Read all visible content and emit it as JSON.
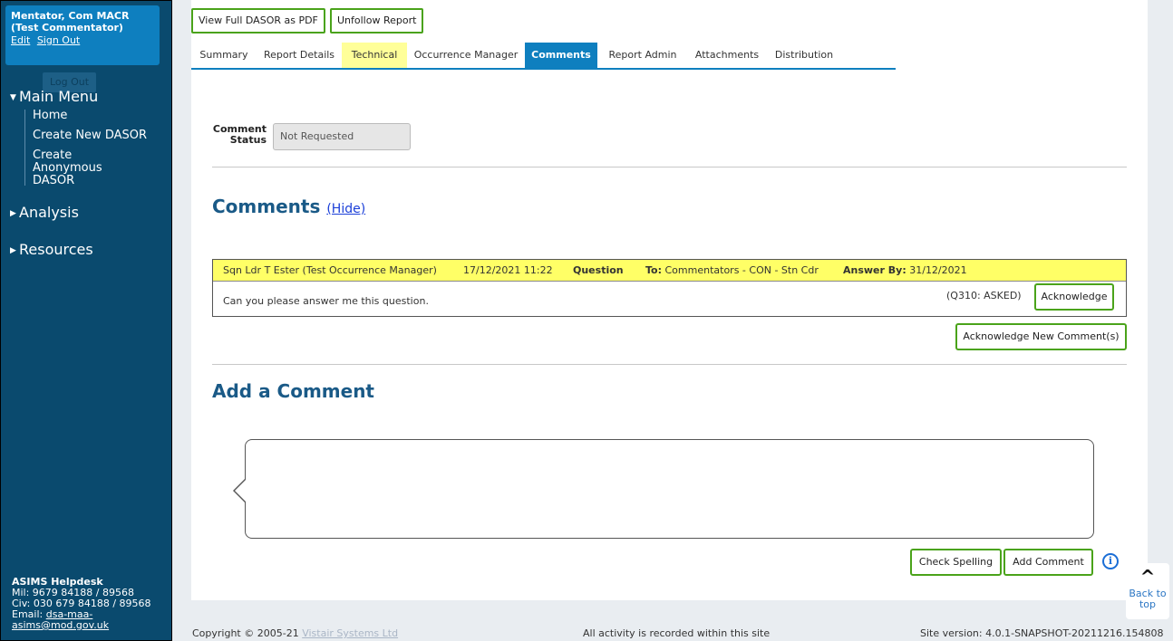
{
  "sidebar": {
    "user_name": "Mentator, Com MACR (Test Commentator)",
    "edit_label": "Edit",
    "signout_label": "Sign Out",
    "logout_label": "Log Out",
    "main_menu_label": "Main Menu",
    "main_menu_items": [
      {
        "label": "Home"
      },
      {
        "label": "Create New DASOR"
      },
      {
        "label": "Create Anonymous DASOR"
      }
    ],
    "analysis_label": "Analysis",
    "resources_label": "Resources",
    "helpdesk": {
      "title": "ASIMS Helpdesk",
      "mil": "Mil: 9679 84188 / 89568",
      "civ": "Civ: 030 679 84188 / 89568",
      "email_prefix": "Email: ",
      "email": "dsa-maa-asims@mod.gov.uk"
    }
  },
  "toolbar": {
    "view_pdf_label": "View Full DASOR as PDF",
    "unfollow_label": "Unfollow Report"
  },
  "tabs": [
    {
      "label": "Summary",
      "state": "normal"
    },
    {
      "label": "Report Details",
      "state": "normal"
    },
    {
      "label": "Technical",
      "state": "highlight"
    },
    {
      "label": "Occurrence Manager",
      "state": "normal"
    },
    {
      "label": "Comments",
      "state": "active"
    },
    {
      "label": "Report Admin",
      "state": "normal"
    },
    {
      "label": "Attachments",
      "state": "normal"
    },
    {
      "label": "Distribution",
      "state": "normal"
    }
  ],
  "comment_status": {
    "label_line1": "Comment",
    "label_line2": "Status",
    "value": "Not Requested"
  },
  "comments_section": {
    "title": "Comments",
    "hide_link": "(Hide)",
    "items": [
      {
        "author": "Sqn Ldr T Ester (Test Occurrence Manager)",
        "datetime": "17/12/2021 11:22",
        "type": "Question",
        "to_label": "To:",
        "to_value": "Commentators - CON - Stn Cdr",
        "answer_by_label": "Answer By:",
        "answer_by_value": "31/12/2021",
        "text": "Can you please answer me this question.",
        "status": "(Q310: ASKED)",
        "ack_label": "Acknowledge"
      }
    ],
    "ack_new_label": "Acknowledge New Comment(s)"
  },
  "add_comment": {
    "title": "Add a Comment",
    "input_value": "",
    "check_spelling_label": "Check Spelling",
    "add_label": "Add Comment"
  },
  "back_to_top": {
    "line1": "Back to",
    "line2": "top"
  },
  "footer": {
    "copyright": "Copyright © 2005-21 ",
    "company": "Vistair Systems Ltd",
    "activity_notice": "All activity is recorded within this site",
    "site_version": "Site version: 4.0.1-SNAPSHOT-20211216.154808"
  },
  "colors": {
    "sidebar_bg": "#0a4a6e",
    "userbox_bg": "#0e7fbf",
    "tab_active_bg": "#0e7fbf",
    "tab_highlight_bg": "#ffff99",
    "comment_header_bg": "#ffff66",
    "button_border": "#4aa31a",
    "heading_color": "#1a5a87"
  }
}
